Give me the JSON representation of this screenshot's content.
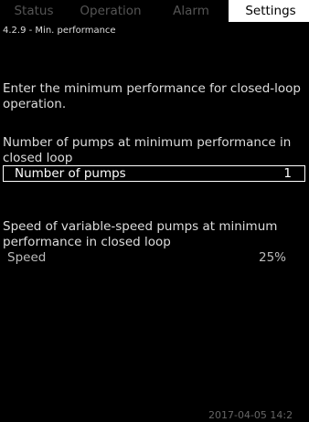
{
  "tabs": [
    "Status",
    "Operation",
    "Alarm",
    "Settings"
  ],
  "active_tab": "Settings",
  "screen_title": "4.2.9 - Min. performance",
  "instruction": [
    "Enter the minimum performance for closed-loop",
    "operation."
  ],
  "pumps_section": {
    "heading": [
      "Number of pumps at minimum performance in",
      "closed loop"
    ],
    "label": "Number of pumps",
    "value": "1"
  },
  "speed_section": {
    "heading": [
      "Speed of variable-speed pumps at minimum",
      "performance in closed loop"
    ],
    "label": "Speed",
    "value": "25%"
  },
  "datetime": "2017-04-05 14:2"
}
